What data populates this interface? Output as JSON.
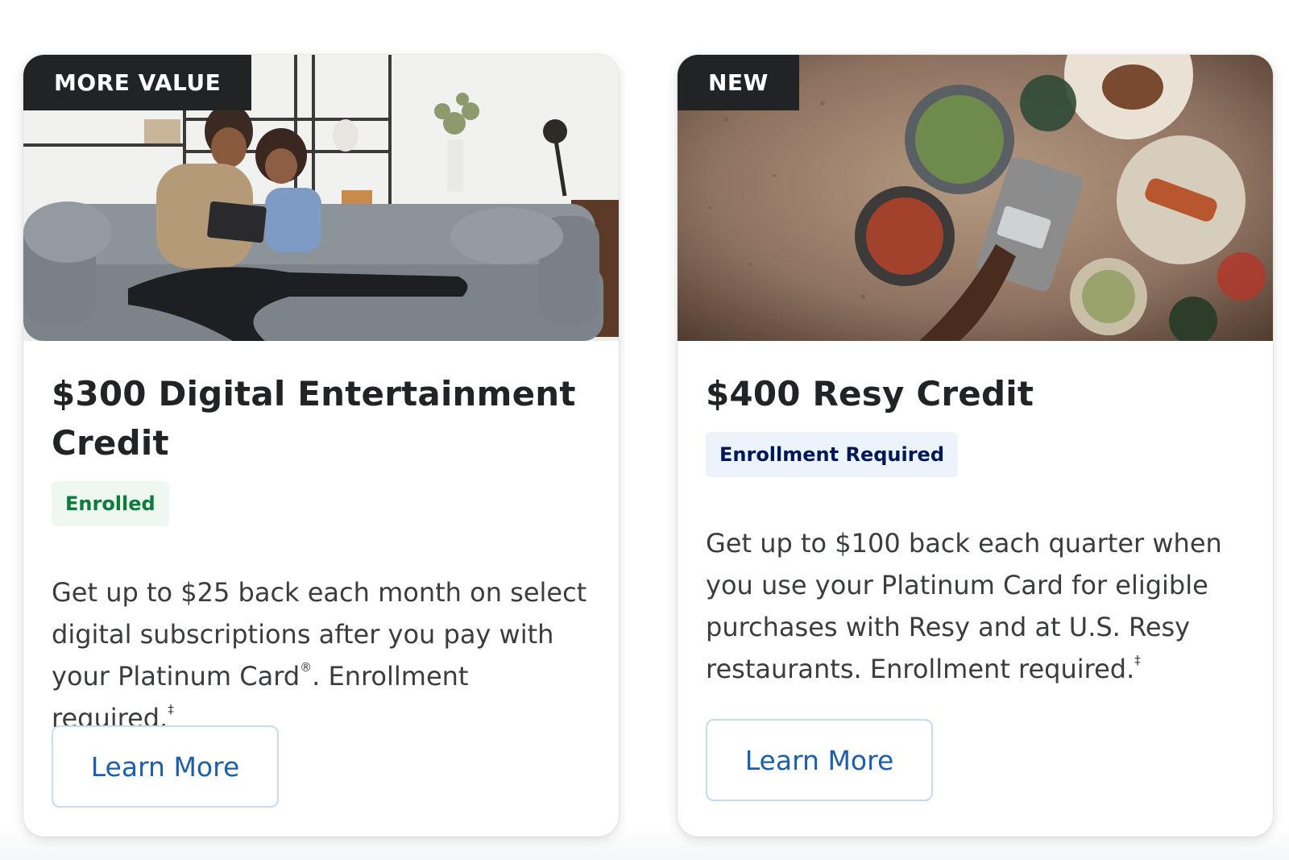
{
  "cards": [
    {
      "badge": "MORE VALUE",
      "title": "$300 Digital Entertainment Credit",
      "status": "Enrolled",
      "description": "Get up to $25 back each month on select digital subscriptions after you pay with your Platinum Card",
      "description_mark": "®",
      "description_tail": ". Enrollment required.",
      "footnote_mark": "‡",
      "button_label": "Learn More",
      "image_icon": "family-on-sofa-image"
    },
    {
      "badge": "NEW",
      "title": "$400 Resy Credit",
      "status": "Enrollment Required",
      "description": "Get up to $100 back each quarter when you use your Platinum Card for eligible purchases with Resy and at U.S. Resy restaurants. Enrollment required.",
      "footnote_mark": "‡",
      "button_label": "Learn More",
      "image_icon": "restaurant-table-image"
    }
  ],
  "colors": {
    "badge_bg": "#222325",
    "enrolled_text": "#0c7c3b",
    "enrolled_bg": "#eef8f1",
    "required_text": "#00175a",
    "required_bg": "#ecf3fb",
    "link_blue": "#1b5fae"
  }
}
